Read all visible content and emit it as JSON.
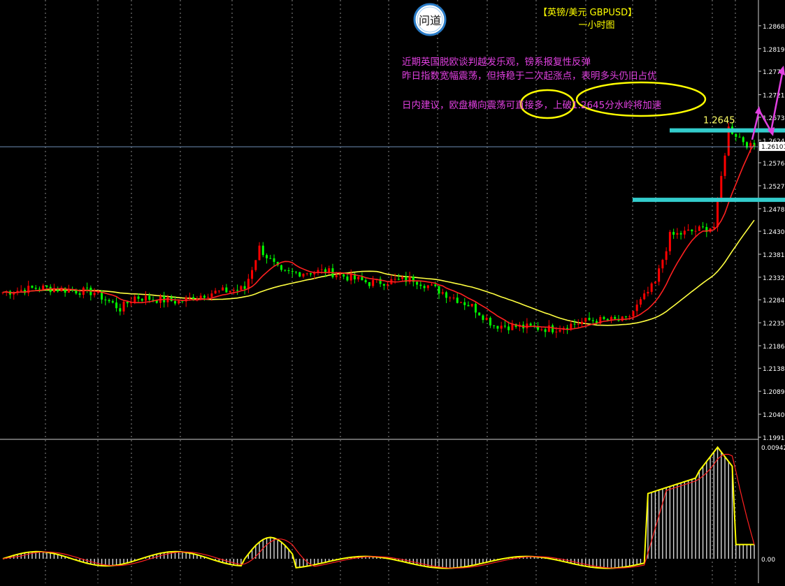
{
  "chart_title": {
    "line1": "【英镑/美元 GBPUSD】",
    "line2": "一小时图"
  },
  "logo_text": "问道",
  "annotations": [
    "近期英国脱欧谈判越发乐观，镑系报复性反弹",
    "昨日指数宽幅震荡，但持稳于二次起涨点，表明多头仍旧占优",
    "日内建议，欧盘横向震荡可直接多，上破1.2645分水岭将加速"
  ],
  "level_label": "1.2645",
  "current_price": "1.26101",
  "colors": {
    "background": "#000000",
    "bull_candle": "#ff0000",
    "bear_candle": "#00ff00",
    "fast_ma": "#ff2020",
    "slow_ma": "#ffff40",
    "level_line": "#33cccc",
    "annotation": "#e040e0",
    "highlight_ellipse": "#ffff00",
    "arrow": "#e040e0"
  },
  "chart_data": [
    {
      "type": "candlestick",
      "title": "GBPUSD H1",
      "ylim": [
        1.1991,
        1.2905
      ],
      "y_ticks": [
        "1.28680",
        "1.28190",
        "1.27710",
        "1.27210",
        "1.26730",
        "1.26240",
        "1.25760",
        "1.25270",
        "1.24780",
        "1.24300",
        "1.23810",
        "1.23320",
        "1.22840",
        "1.22350",
        "1.21860",
        "1.21380",
        "1.20890",
        "1.20400",
        "1.19910"
      ],
      "key_levels": [
        1.2645,
        1.2497
      ],
      "current_price": 1.26101,
      "moving_averages": [
        "fast",
        "slow"
      ]
    },
    {
      "type": "histogram",
      "title": "oscillator",
      "y_ticks": [
        "0.00942",
        "0.00"
      ],
      "ylim": [
        -0.0026,
        0.0095
      ]
    }
  ]
}
